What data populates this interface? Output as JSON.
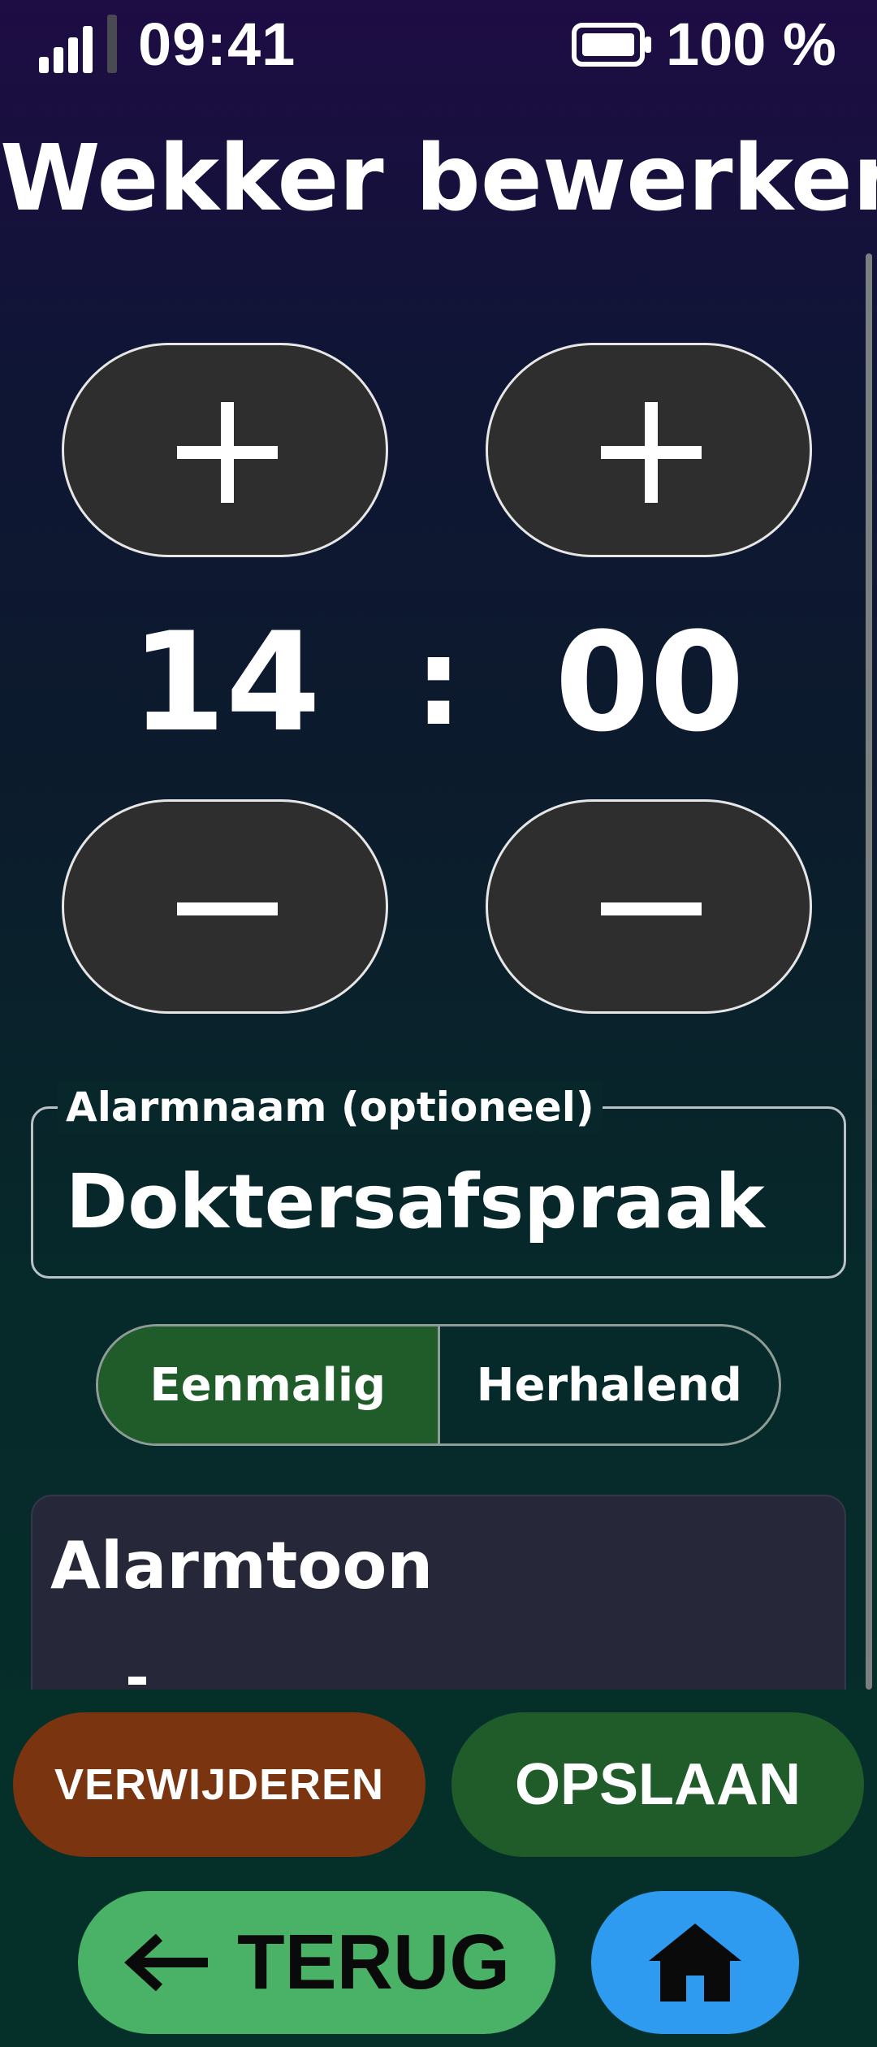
{
  "status_bar": {
    "time": "09:41",
    "battery": "100 %",
    "signal_icon": "signal-icon",
    "battery_icon": "battery-icon"
  },
  "title": "Wekker bewerken",
  "time_picker": {
    "hour": "14",
    "separator": ":",
    "minute": "00",
    "increment_icon": "plus-icon",
    "decrement_icon": "minus-icon"
  },
  "name_field": {
    "label": "Alarmnaam (optioneel)",
    "value": "Doktersafspraak"
  },
  "repeat_toggle": {
    "options": [
      "Eenmalig",
      "Herhalend"
    ],
    "selected": "Eenmalig"
  },
  "sound_card": {
    "title": "Alarmtoon"
  },
  "actions": {
    "delete_label": "VERWIJDEREN",
    "save_label": "OPSLAAN",
    "back_label": "TERUG",
    "back_icon": "arrow-left-icon",
    "home_icon": "home-icon"
  },
  "colors": {
    "delete": "#7a3410",
    "save": "#1f5c2a",
    "back": "#4ab266",
    "home": "#2f9bf0",
    "stepper": "#2e2e2e",
    "selected_segment": "#1f5c2a",
    "card": "#262839"
  }
}
